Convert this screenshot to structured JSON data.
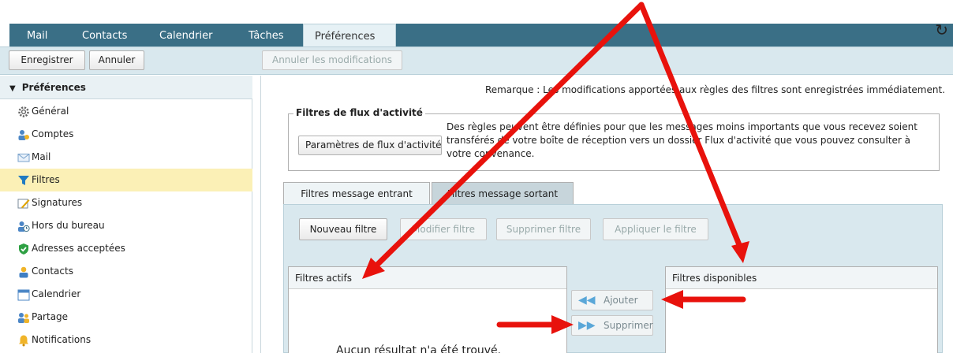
{
  "tabs": [
    {
      "label": "Mail"
    },
    {
      "label": "Contacts"
    },
    {
      "label": "Calendrier"
    },
    {
      "label": "Tâches"
    },
    {
      "label": "Préférences"
    }
  ],
  "toolbar": {
    "save_label": "Enregistrer",
    "cancel_label": "Annuler",
    "undo_label": "Annuler les modifications"
  },
  "sidebar": {
    "heading": "Préférences",
    "items": [
      {
        "label": "Général",
        "icon": "gear-icon"
      },
      {
        "label": "Comptes",
        "icon": "accounts-icon"
      },
      {
        "label": "Mail",
        "icon": "envelope-icon"
      },
      {
        "label": "Filtres",
        "icon": "filter-icon",
        "selected": true
      },
      {
        "label": "Signatures",
        "icon": "signature-icon"
      },
      {
        "label": "Hors du bureau",
        "icon": "out-of-office-icon"
      },
      {
        "label": "Adresses acceptées",
        "icon": "shield-check-icon"
      },
      {
        "label": "Contacts",
        "icon": "contact-icon"
      },
      {
        "label": "Calendrier",
        "icon": "calendar-icon"
      },
      {
        "label": "Partage",
        "icon": "sharing-icon"
      },
      {
        "label": "Notifications",
        "icon": "bell-icon"
      }
    ]
  },
  "main": {
    "remark": "Remarque : Les modifications apportées aux règles des filtres sont enregistrées immédiatement.",
    "activity": {
      "legend": "Filtres de flux d'activité",
      "button_label": "Paramètres de flux d'activité",
      "description": "Des règles peuvent être définies pour que les messages moins importants que vous recevez soient transférés de votre boîte de réception vers un dossier Flux d'activité que vous pouvez consulter à votre convenance."
    },
    "subtabs": [
      {
        "label": "Filtres message entrant"
      },
      {
        "label": "Filtres message sortant"
      }
    ],
    "actions": {
      "new": "Nouveau filtre",
      "edit": "Modifier filtre",
      "delete": "Supprimer filtre",
      "apply": "Appliquer le filtre"
    },
    "active_filters": {
      "header": "Filtres actifs",
      "empty": "Aucun résultat n'a été trouvé."
    },
    "available_filters": {
      "header": "Filtres disponibles"
    },
    "move": {
      "add": "Ajouter",
      "remove": "Supprimer"
    }
  },
  "colors": {
    "tab_bar": "#3a6f86",
    "toolbar": "#d9e8ee",
    "selected_item": "#fbf0b6",
    "annotation_arrow": "#e8120c"
  }
}
